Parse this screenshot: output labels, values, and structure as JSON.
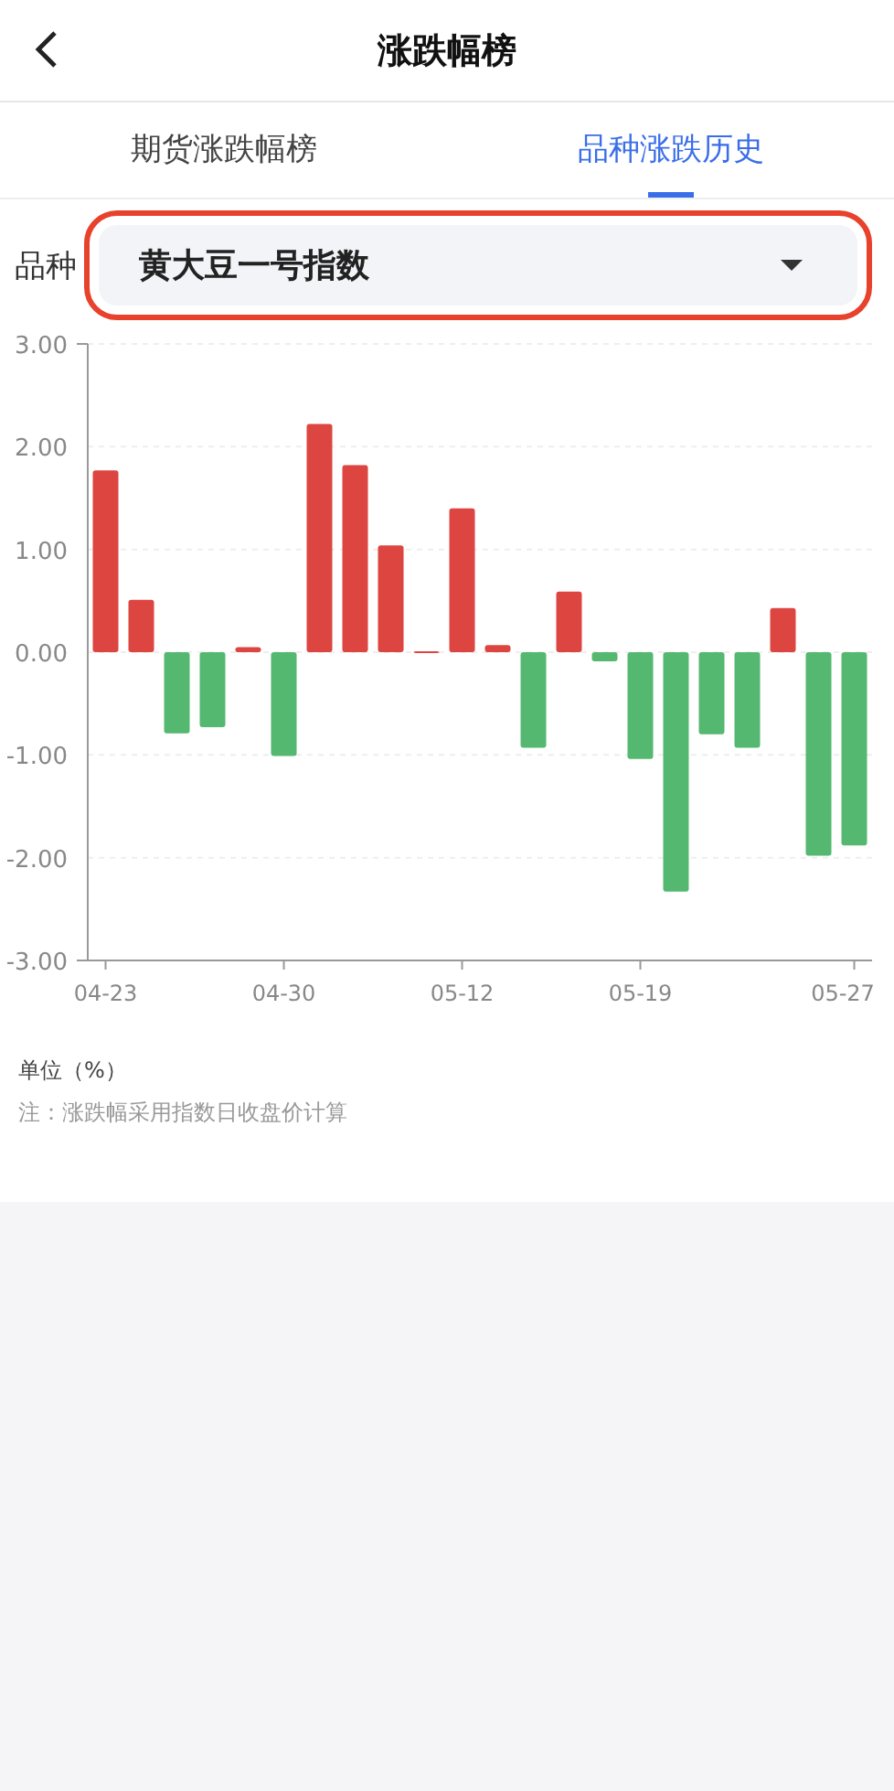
{
  "header": {
    "title": "涨跌幅榜"
  },
  "tabs": [
    {
      "label": "期货涨跌幅榜",
      "selected": false
    },
    {
      "label": "品种涨跌历史",
      "selected": true
    }
  ],
  "selector": {
    "label": "品种",
    "value": "黄大豆一号指数",
    "highlighted": true
  },
  "chart_data": {
    "type": "bar",
    "stacked": true,
    "grid": true,
    "categories": [
      "04-23",
      null,
      null,
      null,
      null,
      "04-30",
      null,
      null,
      null,
      null,
      "05-12",
      null,
      null,
      null,
      null,
      "05-19",
      null,
      null,
      null,
      null,
      null,
      "05-27"
    ],
    "series": [
      {
        "color": "#dd4540",
        "values": [
          1.77,
          0.51,
          null,
          null,
          0.05,
          null,
          2.22,
          1.82,
          1.04,
          0.01,
          1.4,
          0.07,
          null,
          0.59,
          null,
          null,
          null,
          null,
          null,
          0.43,
          null,
          null
        ]
      },
      {
        "color": "#55b870",
        "values": [
          null,
          null,
          -0.79,
          -0.73,
          null,
          -1.01,
          null,
          null,
          null,
          null,
          null,
          null,
          -0.93,
          null,
          -0.09,
          -1.04,
          -2.33,
          -0.8,
          -0.93,
          null,
          -1.98,
          -1.88
        ]
      }
    ],
    "ylim": [
      -3,
      3
    ],
    "yticks": [
      {
        "value": 3,
        "label": "3.00"
      },
      {
        "value": 2,
        "label": "2.00"
      },
      {
        "value": 1,
        "label": "1.00"
      },
      {
        "value": 0,
        "label": "0.00"
      },
      {
        "value": -1,
        "label": "-1.00"
      },
      {
        "value": -2,
        "label": "-2.00"
      },
      {
        "value": -3,
        "label": "-3.00"
      }
    ]
  },
  "unit": "单位（%）",
  "note": "注：涨跌幅采用指数日收盘价计算"
}
